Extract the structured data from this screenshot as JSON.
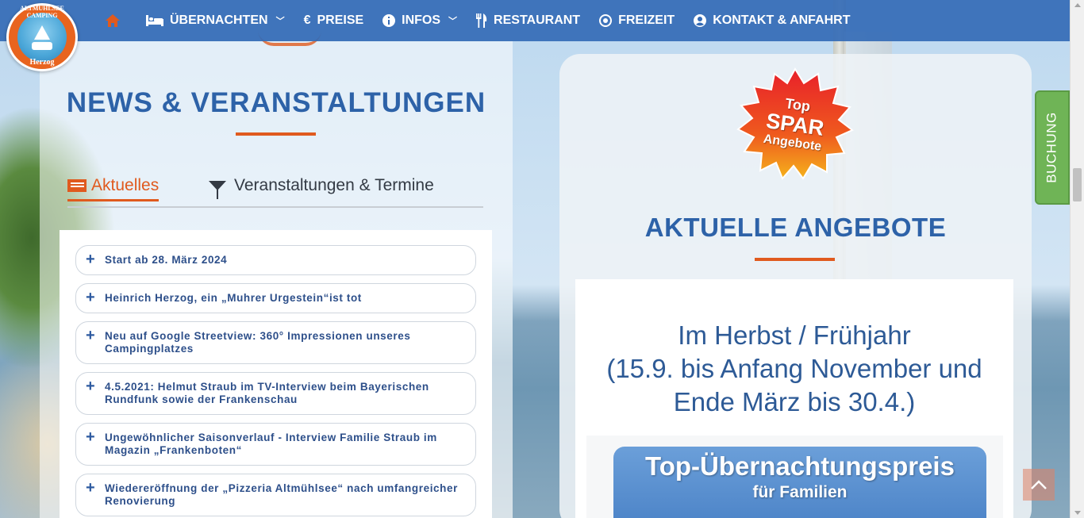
{
  "nav": {
    "items": [
      {
        "icon": "bed-icon",
        "label": "ÜBERNACHTEN",
        "dropdown": true
      },
      {
        "icon": "euro-icon",
        "label": "PREISE",
        "dropdown": false
      },
      {
        "icon": "info-icon",
        "label": "INFOS",
        "dropdown": true
      },
      {
        "icon": "cutlery-icon",
        "label": "RESTAURANT",
        "dropdown": false
      },
      {
        "icon": "target-icon",
        "label": "FREIZEIT",
        "dropdown": false
      },
      {
        "icon": "user-icon",
        "label": "KONTAKT & ANFAHRT",
        "dropdown": false
      }
    ],
    "glyphs": {
      "euro": "€",
      "info": "i",
      "chevron": "﹀"
    }
  },
  "logo": {
    "ring_text": "ALTMÜHLSEE CAMPING",
    "sub_text": "Herzog"
  },
  "news": {
    "title": "NEWS & VERANSTALTUNGEN",
    "tabs": [
      {
        "label": "Aktuelles",
        "active": true
      },
      {
        "label": "Veranstaltungen & Termine",
        "active": false
      }
    ],
    "items": [
      "Start ab 28. März 2024",
      "Heinrich Herzog, ein „Muhrer Urgestein“ist tot",
      "Neu auf Google Streetview: 360° Impressionen unseres Campingplatzes",
      "4.5.2021: Helmut Straub im TV-Interview beim Bayerischen Rundfunk sowie der Frankenschau",
      "Ungewöhnlicher Saisonverlauf - Interview Familie Straub im Magazin „Frankenboten“",
      "Wiedereröffnung der „Pizzeria Altmühlsee“ nach umfangreicher Renovierung"
    ]
  },
  "badge": {
    "top": "Top",
    "mid": "SPAR",
    "bottom": "Angebote"
  },
  "offers": {
    "title": "AKTUELLE ANGEBOTE",
    "text_lines": [
      "Im Herbst / Frühjahr",
      "(15.9. bis Anfang November und",
      "Ende März bis 30.4.)"
    ],
    "banner_title": "Top-Übernachtungspreis",
    "banner_sub": "für Familien"
  },
  "booking": {
    "label": "BUCHUNG"
  },
  "colors": {
    "nav_bg": "#346bb6",
    "accent": "#e05a1e",
    "title_blue": "#2d62a8",
    "booking_green": "#6fb456"
  }
}
